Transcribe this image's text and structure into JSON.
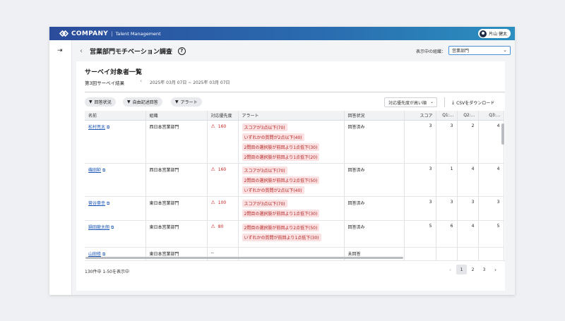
{
  "brand": {
    "name": "COMPANY",
    "separator": "|",
    "product": "Talent Management"
  },
  "user": {
    "name": "片山 健太"
  },
  "header": {
    "title": "営業部門モチベーション調査",
    "org_label": "表示中の組織：",
    "org_value": "営業部門"
  },
  "card": {
    "title": "サーベイ対象者一覧",
    "survey_name": "第3回サーベイ結果",
    "date_range": "2025年 03月 07日 ~ 2025年 03月 07日"
  },
  "filters": [
    "回答状況",
    "自由記述回答",
    "アラート"
  ],
  "sort": {
    "value": "対応優先度が高い順"
  },
  "csv_button": "CSVをダウンロード",
  "table": {
    "columns": [
      "名前",
      "組織",
      "対応優先度",
      "アラート",
      "回答状況",
      "スコア",
      "Q1:...",
      "Q2:...",
      "Q3:..."
    ],
    "rows": [
      {
        "name": "松村亮太",
        "org": "西日本営業部門",
        "priority": "160",
        "alerts": [
          "スコアが3点以下(70)",
          "いずれかの質問が2点以下(40)",
          "2問目の選択肢が前回より1点低下(30)",
          "2問目の選択肢が前回より1点低下(20)"
        ],
        "status": "回答済み",
        "score": "3",
        "q1": "3",
        "q2": "2",
        "q3": "4"
      },
      {
        "name": "磯田勲",
        "org": "西日本営業部門",
        "priority": "160",
        "alerts": [
          "スコアが3点以下(70)",
          "2問目の選択肢が前回より2点低下(50)",
          "いずれかの質問が2点以下(40)"
        ],
        "status": "回答済み",
        "score": "3",
        "q1": "1",
        "q2": "4",
        "q3": "4"
      },
      {
        "name": "菅谷豪幸",
        "org": "東日本営業部門",
        "priority": "100",
        "alerts": [
          "スコアが3点以下(70)",
          "2問目の選択肢が前回より1点低下(30)"
        ],
        "status": "回答済み",
        "score": "3",
        "q1": "3",
        "q2": "3",
        "q3": "3"
      },
      {
        "name": "鍋田龍太朗",
        "org": "東日本営業部門",
        "priority": "80",
        "alerts": [
          "2問目の選択肢が前回より2点低下(50)",
          "いずれかの質問が前回より1点低下(30)"
        ],
        "status": "回答済み",
        "score": "5",
        "q1": "6",
        "q2": "4",
        "q3": "5"
      },
      {
        "name": "山田修",
        "org": "東日本営業部門",
        "priority": "--",
        "alerts": [],
        "status": "未回答",
        "score": "",
        "q1": "",
        "q2": "",
        "q3": ""
      }
    ]
  },
  "footer": {
    "count_text": "130件中 1-50を表示中",
    "pages": [
      "1",
      "2",
      "3"
    ]
  },
  "colors": {
    "accent": "#2a6db0",
    "alert": "#c92020",
    "alert_bg": "#fbe1e1",
    "link": "#1a56b5"
  }
}
